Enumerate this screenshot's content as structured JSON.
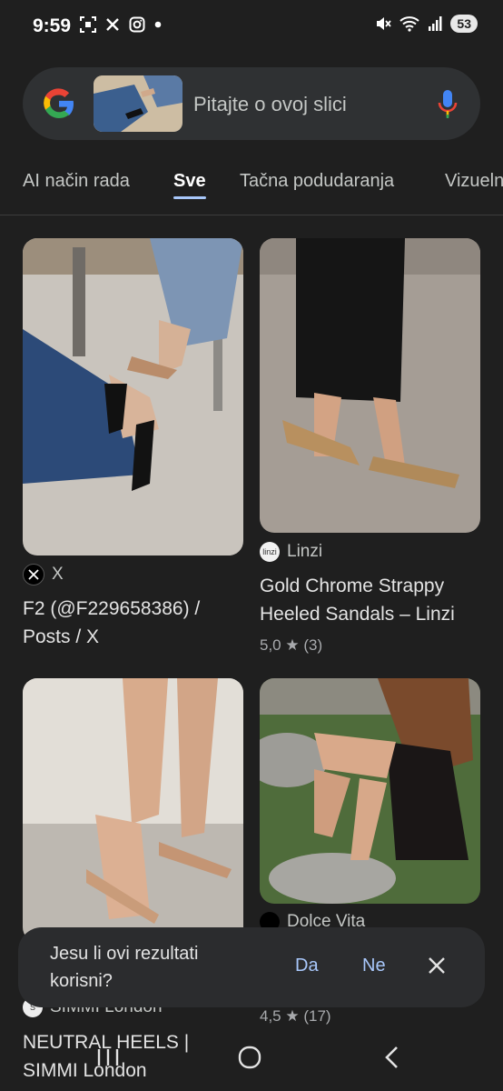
{
  "status_bar": {
    "time": "9:59",
    "battery": "53",
    "icons_left": [
      "screenshot-icon",
      "x-icon",
      "instagram-icon",
      "dot-icon"
    ],
    "icons_right": [
      "mute-icon",
      "wifi-icon",
      "signal-icon",
      "battery-icon"
    ]
  },
  "search": {
    "placeholder": "Pitajte o ovoj slici",
    "logo": "google-icon",
    "mic": "mic-icon"
  },
  "tabs": [
    {
      "label": "AI način rada",
      "active": false
    },
    {
      "label": "Sve",
      "active": true
    },
    {
      "label": "Tačna podudaranja",
      "active": false
    },
    {
      "label": "Vizuelni",
      "active": false
    }
  ],
  "results": [
    {
      "source": "X",
      "title_line1": "F2 (@F229658386) /",
      "title_line2": "Posts / X"
    },
    {
      "source": "Linzi",
      "title_line1": "Gold Chrome Strappy",
      "title_line2": "Heeled Sandals – Linzi",
      "rating": "5,0",
      "reviews": "(3)"
    },
    {
      "source": "SIMMI London",
      "title_line1": "NEUTRAL HEELS |",
      "title_line2": "SIMMI London"
    },
    {
      "source": "Dolce Vita",
      "rating": "4,5",
      "reviews": "(17)"
    }
  ],
  "feedback": {
    "question": "Jesu li ovi rezultati korisni?",
    "yes": "Da",
    "no": "Ne"
  },
  "colors": {
    "background": "#1f1f1f",
    "accent": "#a8c7fa",
    "surface": "#2f3133"
  }
}
